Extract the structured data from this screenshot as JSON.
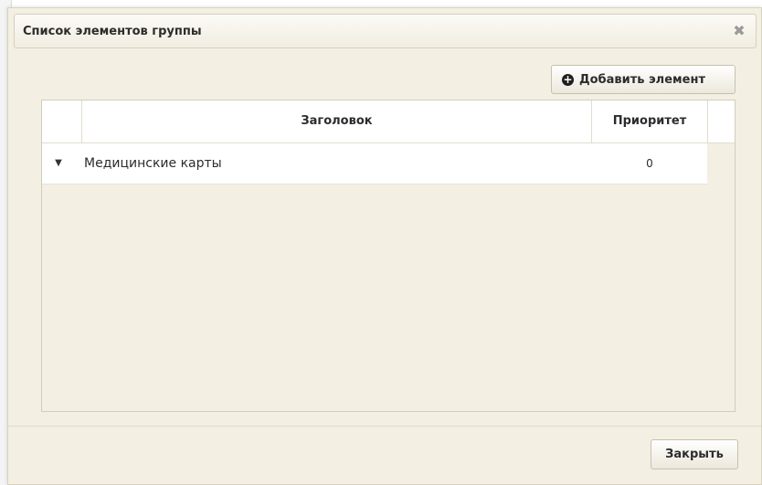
{
  "dialog": {
    "title": "Список элементов группы",
    "close_glyph": "✖",
    "close_icon": "close-icon"
  },
  "toolbar": {
    "add_label": "Добавить элемент",
    "add_icon": "plus-circle-icon"
  },
  "table": {
    "columns": [
      "Заголовок",
      "Приоритет"
    ],
    "rows": [
      {
        "expand_icon": "chevron-down-icon",
        "title": "Медицинские карты",
        "priority": "0"
      }
    ]
  },
  "footer": {
    "close_label": "Закрыть"
  }
}
